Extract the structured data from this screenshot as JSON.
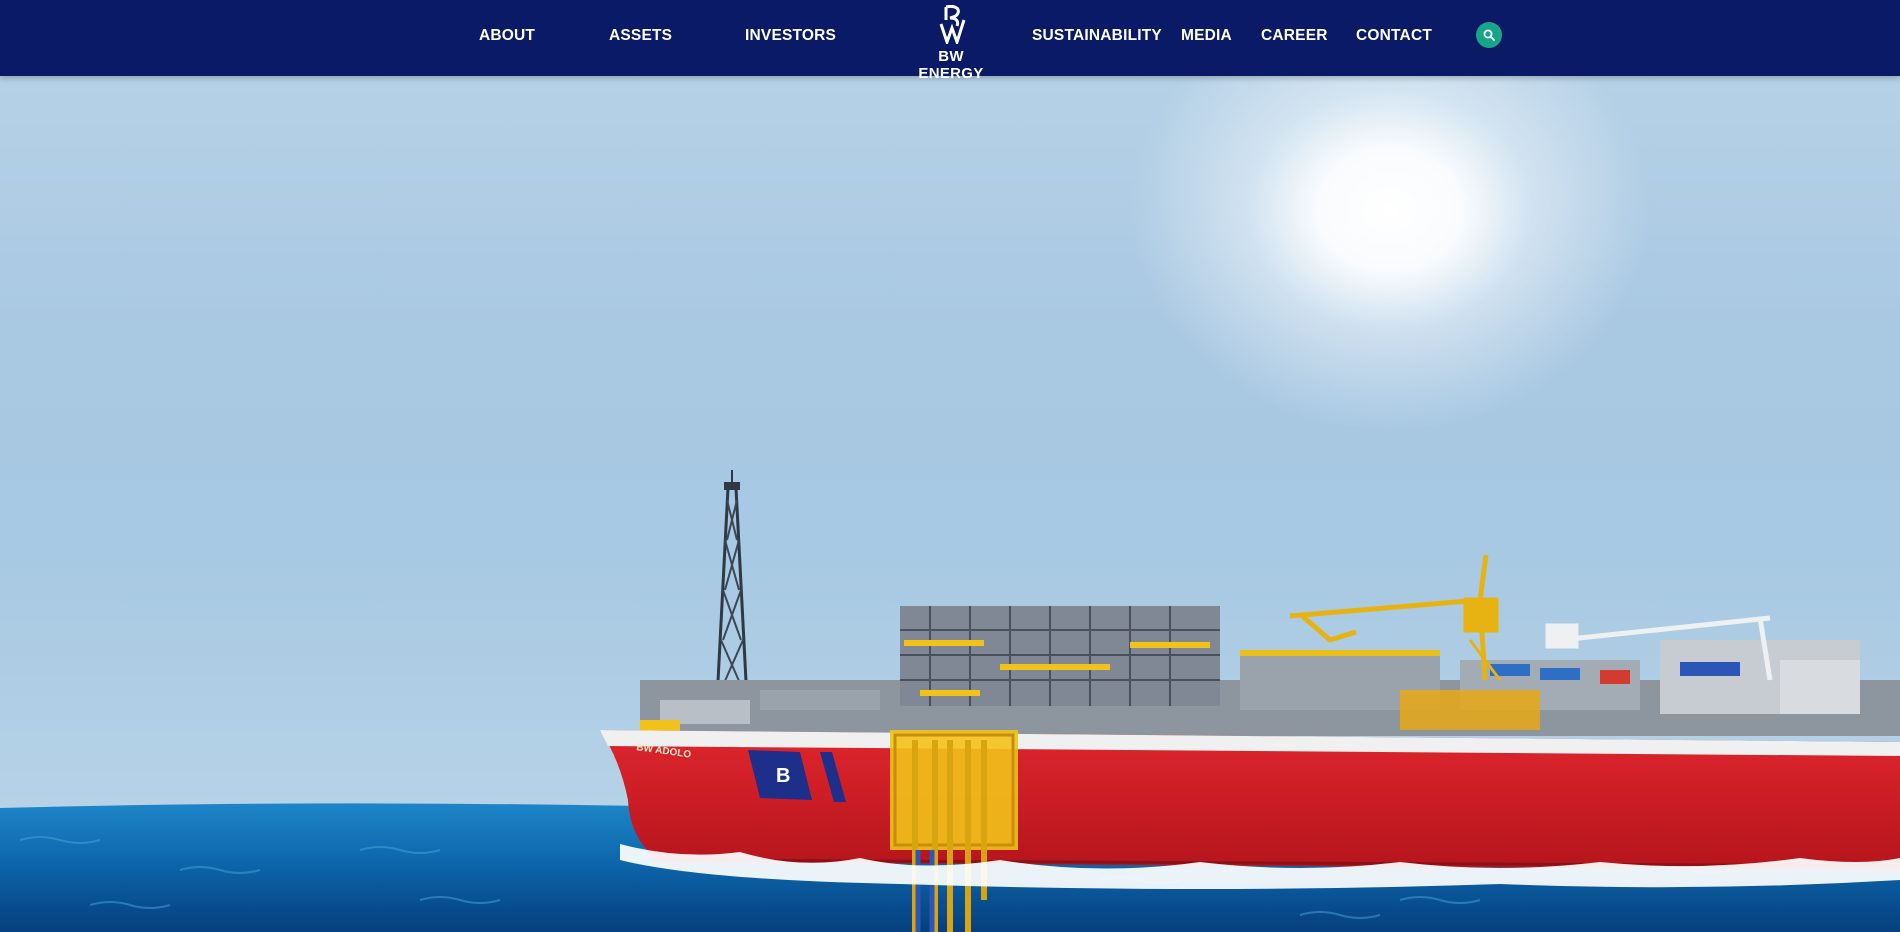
{
  "brand": {
    "name": "BW ENERGY",
    "colors": {
      "navy": "#0a1a66",
      "accent": "#17a58a",
      "hull": "#d8222a"
    }
  },
  "nav": {
    "left": [
      {
        "label": "ABOUT"
      },
      {
        "label": "ASSETS"
      },
      {
        "label": "INVESTORS"
      }
    ],
    "right": [
      {
        "label": "SUSTAINABILITY"
      },
      {
        "label": "MEDIA"
      },
      {
        "label": "CAREER"
      },
      {
        "label": "CONTACT"
      }
    ],
    "search_icon": "search-icon"
  },
  "hero": {
    "image": "offshore-fpso-vessel",
    "vessel_name": "BW ADOLO"
  }
}
